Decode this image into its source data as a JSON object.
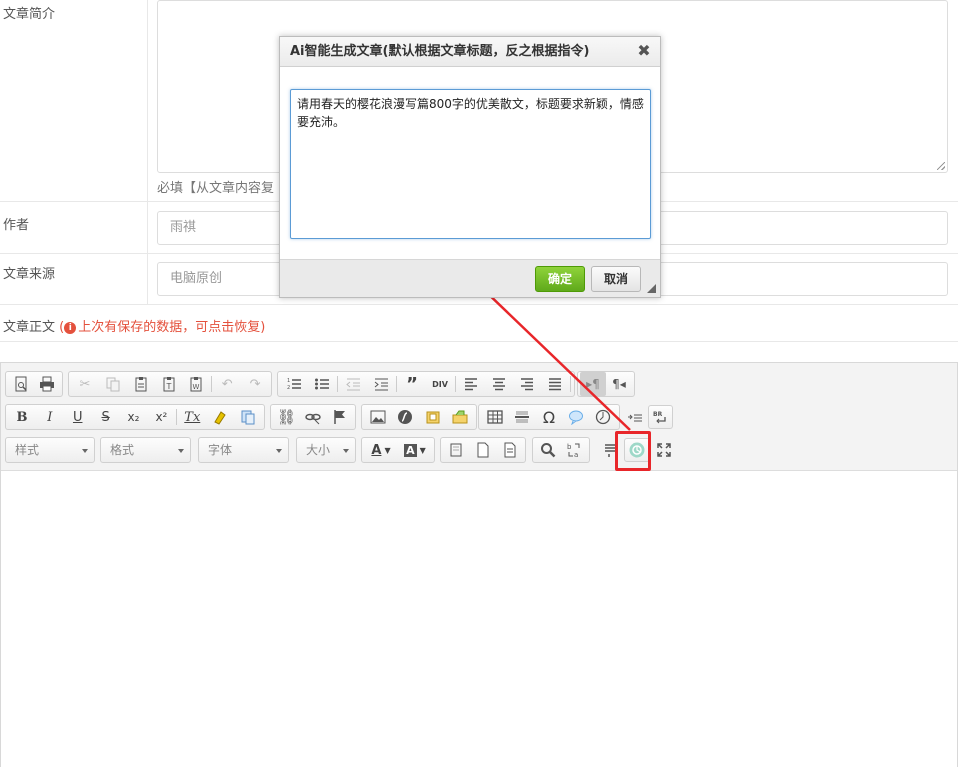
{
  "form": {
    "summary_label": "文章简介",
    "summary_help": "必填【从文章内容复",
    "author_label": "作者",
    "author_placeholder": "雨祺",
    "source_label": "文章来源",
    "source_placeholder": "电脑原创",
    "body_label": "文章正文",
    "restore_notice": "上次有保存的数据，可点击恢复",
    "restore_open": "(",
    "restore_close": ")",
    "restore_icon": "i"
  },
  "toolbar": {
    "combo_style": "样式",
    "combo_format": "格式",
    "combo_font": "字体",
    "combo_size": "大小",
    "ai_button_icon": "openai-icon",
    "highlight_color": "#e8262a"
  },
  "dialog": {
    "title": "Ai智能生成文章(默认根据文章标题，反之根据指令)",
    "prompt_text": "请用春天的樱花浪漫写篇800字的优美散文，标题要求新颖，情感要充沛。",
    "ok_label": "确定",
    "cancel_label": "取消",
    "close_symbol": "✖"
  },
  "colors": {
    "ok_button": "#6cbf24",
    "annotation": "#e8262a",
    "warning": "#e4513d",
    "focus_border": "#5b9bd5"
  }
}
